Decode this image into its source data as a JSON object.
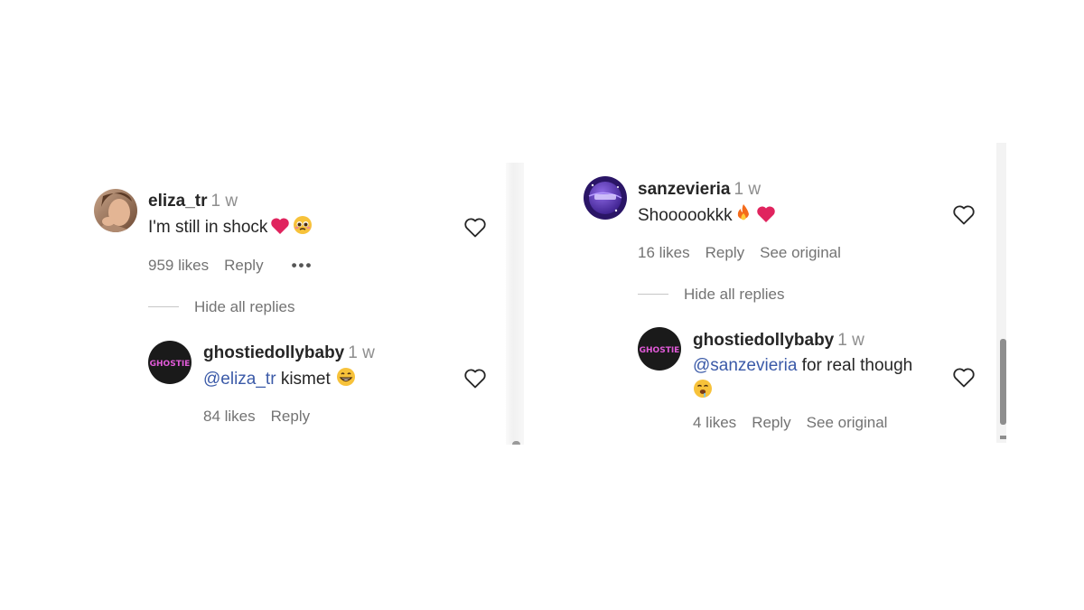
{
  "left": {
    "comment": {
      "username": "eliza_tr",
      "time": "1 w",
      "text": "I'm still in shock",
      "likes": "959 likes",
      "reply": "Reply",
      "more": "•••"
    },
    "hide_replies": "Hide all replies",
    "reply": {
      "username": "ghostiedollybaby",
      "time": "1 w",
      "mention": "@eliza_tr",
      "text": " kismet",
      "likes": "84 likes",
      "reply": "Reply"
    }
  },
  "right": {
    "comment": {
      "username": "sanzevieria",
      "time": "1 w",
      "text": "Shoooookkk",
      "likes": "16 likes",
      "reply": "Reply",
      "see_original": "See original"
    },
    "hide_replies": "Hide all replies",
    "reply": {
      "username": "ghostiedollybaby",
      "time": "1 w",
      "mention": "@sanzevieria",
      "text": " for real though",
      "likes": "4 likes",
      "reply": "Reply",
      "see_original": "See original"
    }
  },
  "avatar_labels": {
    "ghostie": "GHOSTIE"
  },
  "colors": {
    "mention": "#3b5aa8",
    "heart_emoji": "#e0245e",
    "muted": "#737373"
  },
  "icons": [
    "heart-outline-icon",
    "heart-emoji",
    "fire-emoji",
    "grin-emoji",
    "pleading-emoji",
    "drooling-emoji",
    "more-dots-icon"
  ]
}
